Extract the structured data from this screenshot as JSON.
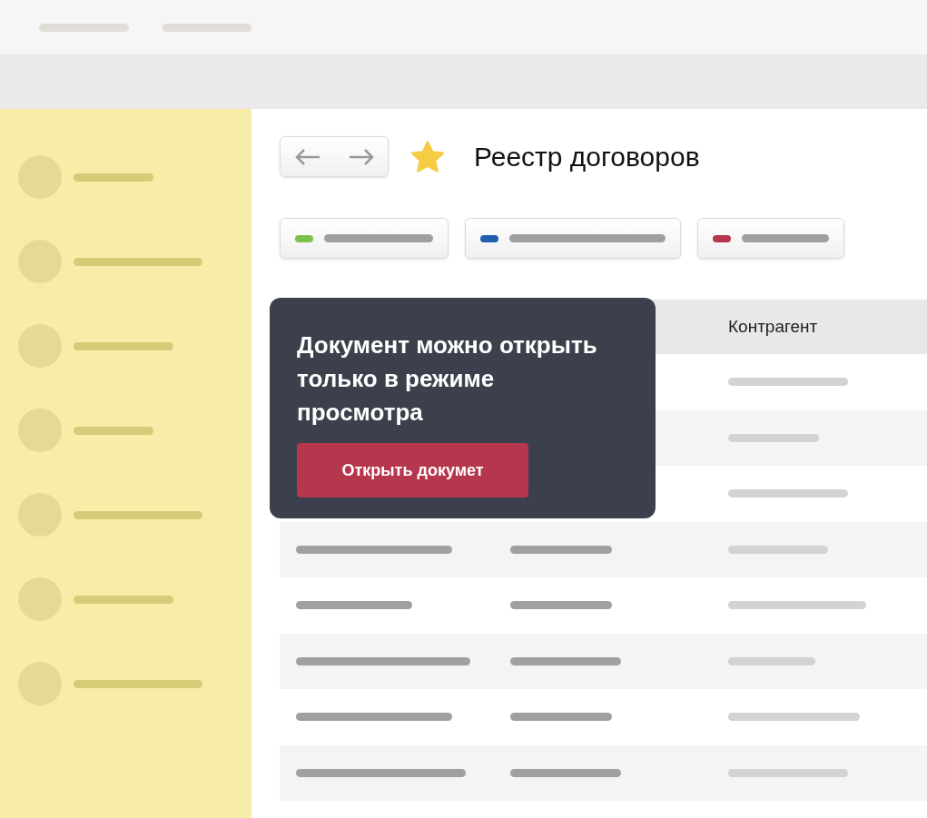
{
  "page": {
    "title": "Реестр договоров",
    "starred": true
  },
  "filters": [
    {
      "color": "#7cc04b"
    },
    {
      "color": "#1f5fad"
    },
    {
      "color": "#b5374e"
    }
  ],
  "table": {
    "column_3": "Контрагент"
  },
  "popover": {
    "message": "Документ можно открыть только в режиме просмотра",
    "button": "Открыть докумет"
  }
}
